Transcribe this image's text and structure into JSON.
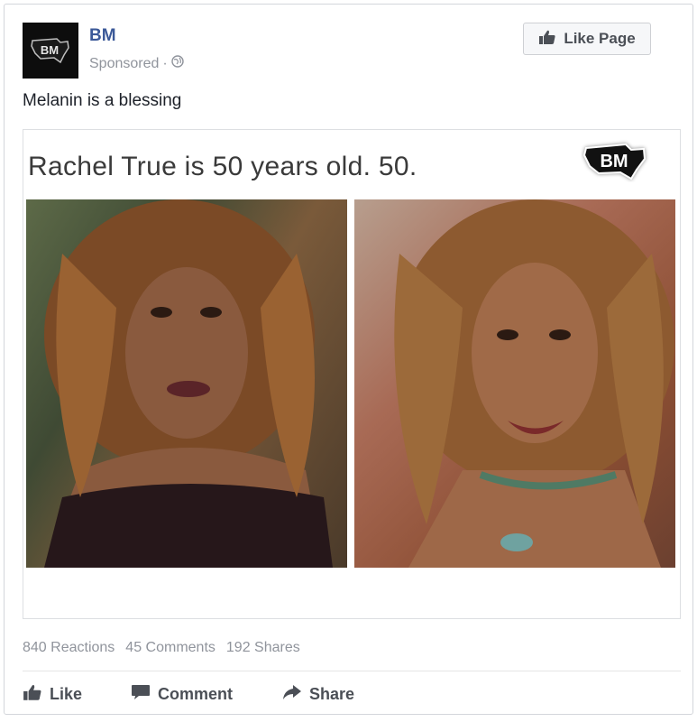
{
  "post": {
    "page_name": "BM",
    "sponsored_label": "Sponsored",
    "separator": "·",
    "like_page_label": "Like Page",
    "text": "Melanin is a blessing"
  },
  "attachment": {
    "headline": "Rachel True is 50 years old. 50."
  },
  "stats": {
    "reactions": "840 Reactions",
    "comments": "45 Comments",
    "shares": "192 Shares"
  },
  "actions": {
    "like_label": "Like",
    "comment_label": "Comment",
    "share_label": "Share"
  },
  "logo": {
    "text": "BM"
  },
  "colors": {
    "brand": "#3b5998",
    "meta_text": "#90949c",
    "action_text": "#4b4f56"
  },
  "icons": [
    "globe-icon",
    "thumbs-up-icon",
    "comment-icon",
    "share-icon"
  ]
}
